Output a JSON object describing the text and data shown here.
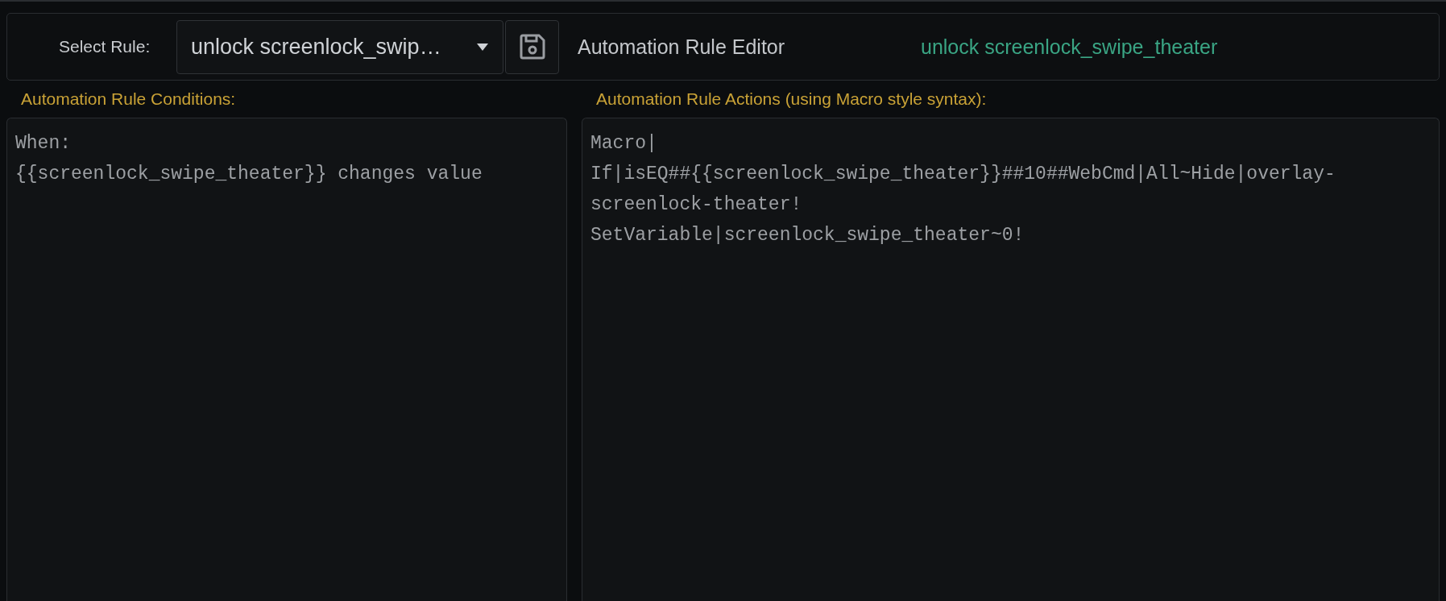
{
  "toolbar": {
    "select_label": "Select Rule:",
    "rule_select": {
      "value": "unlock screenlock_swip…"
    },
    "editor_title": "Automation Rule Editor",
    "rule_name": "unlock screenlock_swipe_theater"
  },
  "conditions": {
    "label": "Automation Rule Conditions:",
    "value": "When:\n{{screenlock_swipe_theater}} changes value"
  },
  "actions": {
    "label": "Automation Rule Actions (using Macro style syntax):",
    "value": "Macro|\nIf|isEQ##{{screenlock_swipe_theater}}##10##WebCmd|All~Hide|overlay-screenlock-theater!\nSetVariable|screenlock_swipe_theater~0!"
  }
}
